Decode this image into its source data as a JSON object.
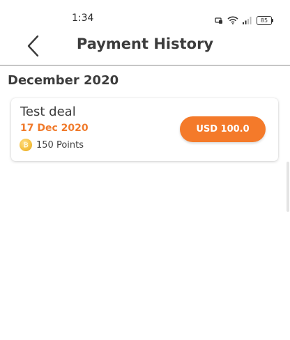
{
  "status_bar": {
    "time": "1:34",
    "battery": "85"
  },
  "header": {
    "title": "Payment History",
    "back_icon": "chevron-left-icon"
  },
  "section": {
    "heading": "December 2020"
  },
  "payments": [
    {
      "name": "Test deal",
      "date": "17 Dec 2020",
      "points": "150 Points",
      "amount": "USD 100.0",
      "coin_icon": "coin-icon"
    }
  ],
  "colors": {
    "accent": "#f47a2a",
    "date": "#f07a2b",
    "title_text": "#3c3c3c"
  }
}
